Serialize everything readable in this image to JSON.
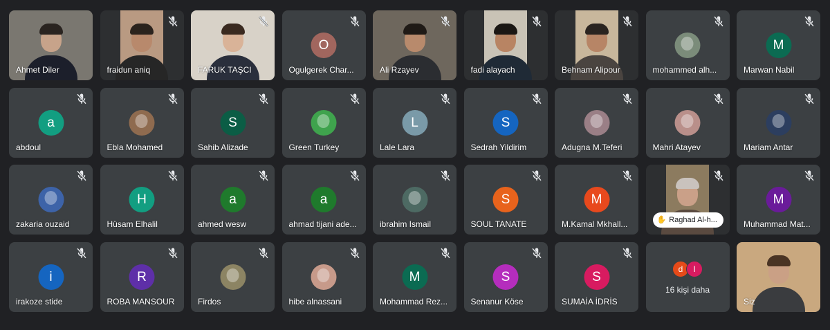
{
  "meeting": {
    "tiles": [
      {
        "name": "Ahmet Diler",
        "kind": "video",
        "bg": "#7a7770",
        "skin": "#c7a38a",
        "hair": "#2a2420",
        "shirt": "#1c1f2b",
        "wide": true,
        "mic": "on"
      },
      {
        "name": "fraidun aniq",
        "kind": "video",
        "bg": "#b99a82",
        "skin": "#b8896c",
        "hair": "#2b231d",
        "shirt": "#262626",
        "mic": "muted"
      },
      {
        "name": "FARUK TAŞCI",
        "kind": "video",
        "bg": "#d8d2c8",
        "skin": "#d9b398",
        "hair": "#3a2a20",
        "shirt": "#2a2f3c",
        "wide": true,
        "mic": "muted"
      },
      {
        "name": "Ogulgerek Char...",
        "kind": "avatar",
        "letter": "O",
        "color": "#a1665e",
        "mic": "muted"
      },
      {
        "name": "Ali Rzayev",
        "kind": "video",
        "bg": "#6e675d",
        "skin": "#b88a6c",
        "hair": "#1f1a16",
        "shirt": "#2b2d31",
        "wide": true,
        "mic": "muted"
      },
      {
        "name": "fadi alayach",
        "kind": "video",
        "bg": "#c9c3b6",
        "skin": "#b88463",
        "hair": "#1b1714",
        "shirt": "#1f2a36",
        "mic": "muted"
      },
      {
        "name": "Behnam Alipour",
        "kind": "video",
        "bg": "#c8b79c",
        "skin": "#b78566",
        "hair": "#2a2420",
        "shirt": "#4a4440",
        "mic": "muted"
      },
      {
        "name": "mohammed alh...",
        "kind": "avatar",
        "letter": "",
        "color": "#7b8c7a",
        "photo": true,
        "mic": "muted"
      },
      {
        "name": "Marwan Nabil",
        "kind": "avatar",
        "letter": "M",
        "color": "#0b6b52",
        "mic": "muted"
      },
      {
        "name": "abdoul",
        "kind": "avatar",
        "letter": "a",
        "color": "#129e81",
        "mic": "muted"
      },
      {
        "name": "Ebla Mohamed",
        "kind": "avatar",
        "letter": "",
        "color": "#8f6b4f",
        "photo": true,
        "mic": "muted"
      },
      {
        "name": "Sahib Alizade",
        "kind": "avatar",
        "letter": "S",
        "color": "#0b5d45",
        "mic": "muted"
      },
      {
        "name": "Green Turkey",
        "kind": "avatar",
        "letter": "",
        "color": "#3fa34d",
        "photo": true,
        "mic": "muted"
      },
      {
        "name": "Lale Lara",
        "kind": "avatar",
        "letter": "L",
        "color": "#7a9aa8",
        "mic": "muted"
      },
      {
        "name": "Sedrah Yildirim",
        "kind": "avatar",
        "letter": "S",
        "color": "#1565c0",
        "mic": "muted"
      },
      {
        "name": "Adugna M.Teferi",
        "kind": "avatar",
        "letter": "",
        "color": "#9a7f86",
        "photo": true,
        "mic": "muted"
      },
      {
        "name": "Mahri Atayev",
        "kind": "avatar",
        "letter": "",
        "color": "#b98f8a",
        "photo": true,
        "mic": "muted"
      },
      {
        "name": "Mariam Antar",
        "kind": "avatar",
        "letter": "",
        "color": "#2c3e5f",
        "photo": true,
        "mic": "muted"
      },
      {
        "name": "zakaria ouzaid",
        "kind": "avatar",
        "letter": "",
        "color": "#3d63a8",
        "photo": true,
        "mic": "muted"
      },
      {
        "name": "Hüsam Elhalil",
        "kind": "avatar",
        "letter": "H",
        "color": "#129e81",
        "mic": "muted"
      },
      {
        "name": "ahmed wesw",
        "kind": "avatar",
        "letter": "a",
        "color": "#1f7a2c",
        "mic": "muted"
      },
      {
        "name": "ahmad tijani ade...",
        "kind": "avatar",
        "letter": "a",
        "color": "#1f7a2c",
        "mic": "muted"
      },
      {
        "name": "ibrahim Ismail",
        "kind": "avatar",
        "letter": "",
        "color": "#4d6a63",
        "photo": true,
        "mic": "muted"
      },
      {
        "name": "SOUL TANATE",
        "kind": "avatar",
        "letter": "S",
        "color": "#e8631c",
        "mic": "muted"
      },
      {
        "name": "M.Kamal Mkhall...",
        "kind": "avatar",
        "letter": "M",
        "color": "#e8491d",
        "mic": "muted"
      },
      {
        "name": "Raghad Al-h...",
        "kind": "video",
        "bg": "#8c7b5f",
        "skin": "#caa088",
        "hair": "#c9c2bd",
        "shirt": "#5a4a40",
        "raised": true,
        "mic": "muted"
      },
      {
        "name": "Muhammad Mat...",
        "kind": "avatar",
        "letter": "M",
        "color": "#6a1b9a",
        "mic": "muted"
      },
      {
        "name": "irakoze stide",
        "kind": "avatar",
        "letter": "i",
        "color": "#1565c0",
        "mic": "muted"
      },
      {
        "name": "ROBA MANSOUR",
        "kind": "avatar",
        "letter": "R",
        "color": "#5e2fa8",
        "mic": "muted"
      },
      {
        "name": "Firdos",
        "kind": "avatar",
        "letter": "",
        "color": "#8c8463",
        "photo": true,
        "mic": "muted"
      },
      {
        "name": "hibe alnassani",
        "kind": "avatar",
        "letter": "",
        "color": "#c79a8a",
        "photo": true,
        "mic": "muted"
      },
      {
        "name": "Mohammad Rez...",
        "kind": "avatar",
        "letter": "M",
        "color": "#0b6b52",
        "mic": "muted"
      },
      {
        "name": "Senanur Köse",
        "kind": "avatar",
        "letter": "S",
        "color": "#b52dbd",
        "mic": "muted"
      },
      {
        "name": "SUMAİA İDRİS",
        "kind": "avatar",
        "letter": "S",
        "color": "#d81b60",
        "mic": "muted"
      },
      {
        "name": "",
        "kind": "more",
        "count_label": "16 kişi daha",
        "minis": [
          {
            "letter": "d",
            "color": "#e64a19"
          },
          {
            "letter": "I",
            "color": "#d81b60"
          }
        ]
      },
      {
        "name": "Siz",
        "kind": "video",
        "bg": "#c9a87f",
        "skin": "#caa085",
        "hair": "#4a3424",
        "shirt": "#3a3c3f",
        "wide": true,
        "mic": "on"
      }
    ]
  }
}
